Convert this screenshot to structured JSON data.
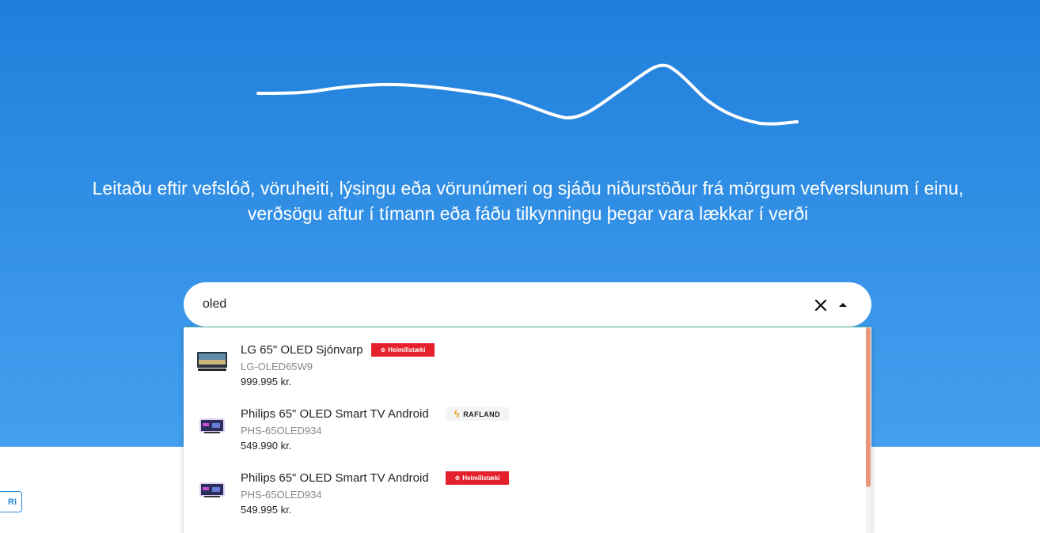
{
  "hero": {
    "tagline_line1": "Leitaðu eftir vefslóð, vöruheiti, lýsingu eða vörunúmeri og sjáðu niðurstöður frá mörgum vefverslunum í einu,",
    "tagline_line2": "verðsögu aftur í tímann eða fáðu tilkynningu þegar vara lækkar í verði",
    "logo_icon": "price-wave-icon",
    "background_color": "#2b8ae2"
  },
  "search": {
    "value": "oled",
    "clear_icon": "close-icon",
    "toggle_icon": "caret-up-icon"
  },
  "results": [
    {
      "name": "LG 65\" OLED Sjónvarp",
      "sku": "LG-OLED65W9",
      "price": "999.995 kr.",
      "store": "Heimilistæki",
      "store_color": "#e4202a"
    },
    {
      "name": "Philips 65\" OLED Smart TV Android",
      "sku": "PHS-65OLED934",
      "price": "549.990 kr.",
      "store": "RAFLAND",
      "store_color": "#f4f4f4"
    },
    {
      "name": "Philips 65\" OLED Smart TV Android",
      "sku": "PHS-65OLED934",
      "price": "549.995 kr.",
      "store": "Heimilistæki",
      "store_color": "#e4202a"
    }
  ],
  "side_button": {
    "label": "RI"
  },
  "colors": {
    "accent": "#2a8ad8",
    "scrollbar": "#e9967a"
  }
}
